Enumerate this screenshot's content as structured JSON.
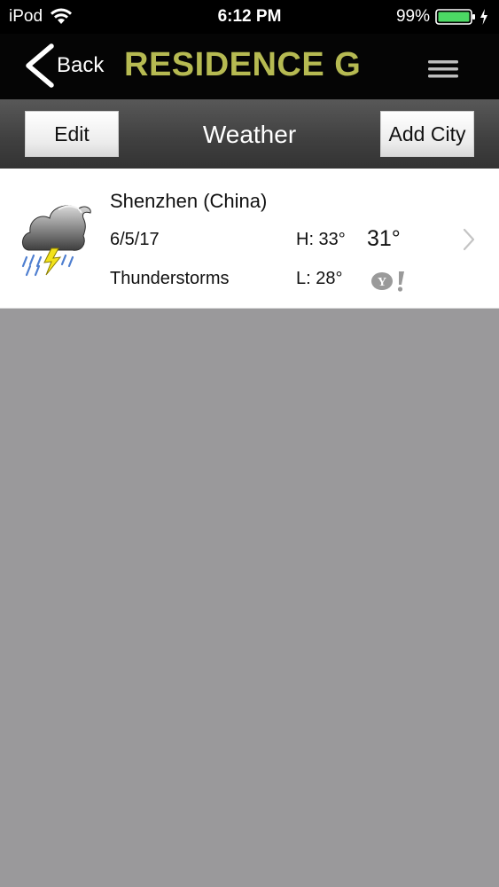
{
  "status_bar": {
    "carrier": "iPod",
    "time": "6:12 PM",
    "battery": "99%",
    "icons": [
      "wifi-icon",
      "battery-icon",
      "charging-bolt-icon"
    ]
  },
  "nav_bar": {
    "back_label": "Back",
    "title": "RESIDENCE G",
    "title_color": "#b6ba52",
    "icons": [
      "back-chevron-icon",
      "hamburger-menu-icon"
    ]
  },
  "toolbar": {
    "edit_label": "Edit",
    "title": "Weather",
    "add_label": "Add City"
  },
  "weather": {
    "items": [
      {
        "city": "Shenzhen (China)",
        "date": "6/5/17",
        "condition": "Thunderstorms",
        "high": "H: 33°",
        "low": "L: 28°",
        "current": "31°",
        "icon": "thunderstorm-icon",
        "provider_icon": "yahoo-icon"
      }
    ]
  },
  "colors": {
    "background": "#9a999b",
    "battery_green": "#4cd964",
    "title_accent": "#b6ba52"
  }
}
